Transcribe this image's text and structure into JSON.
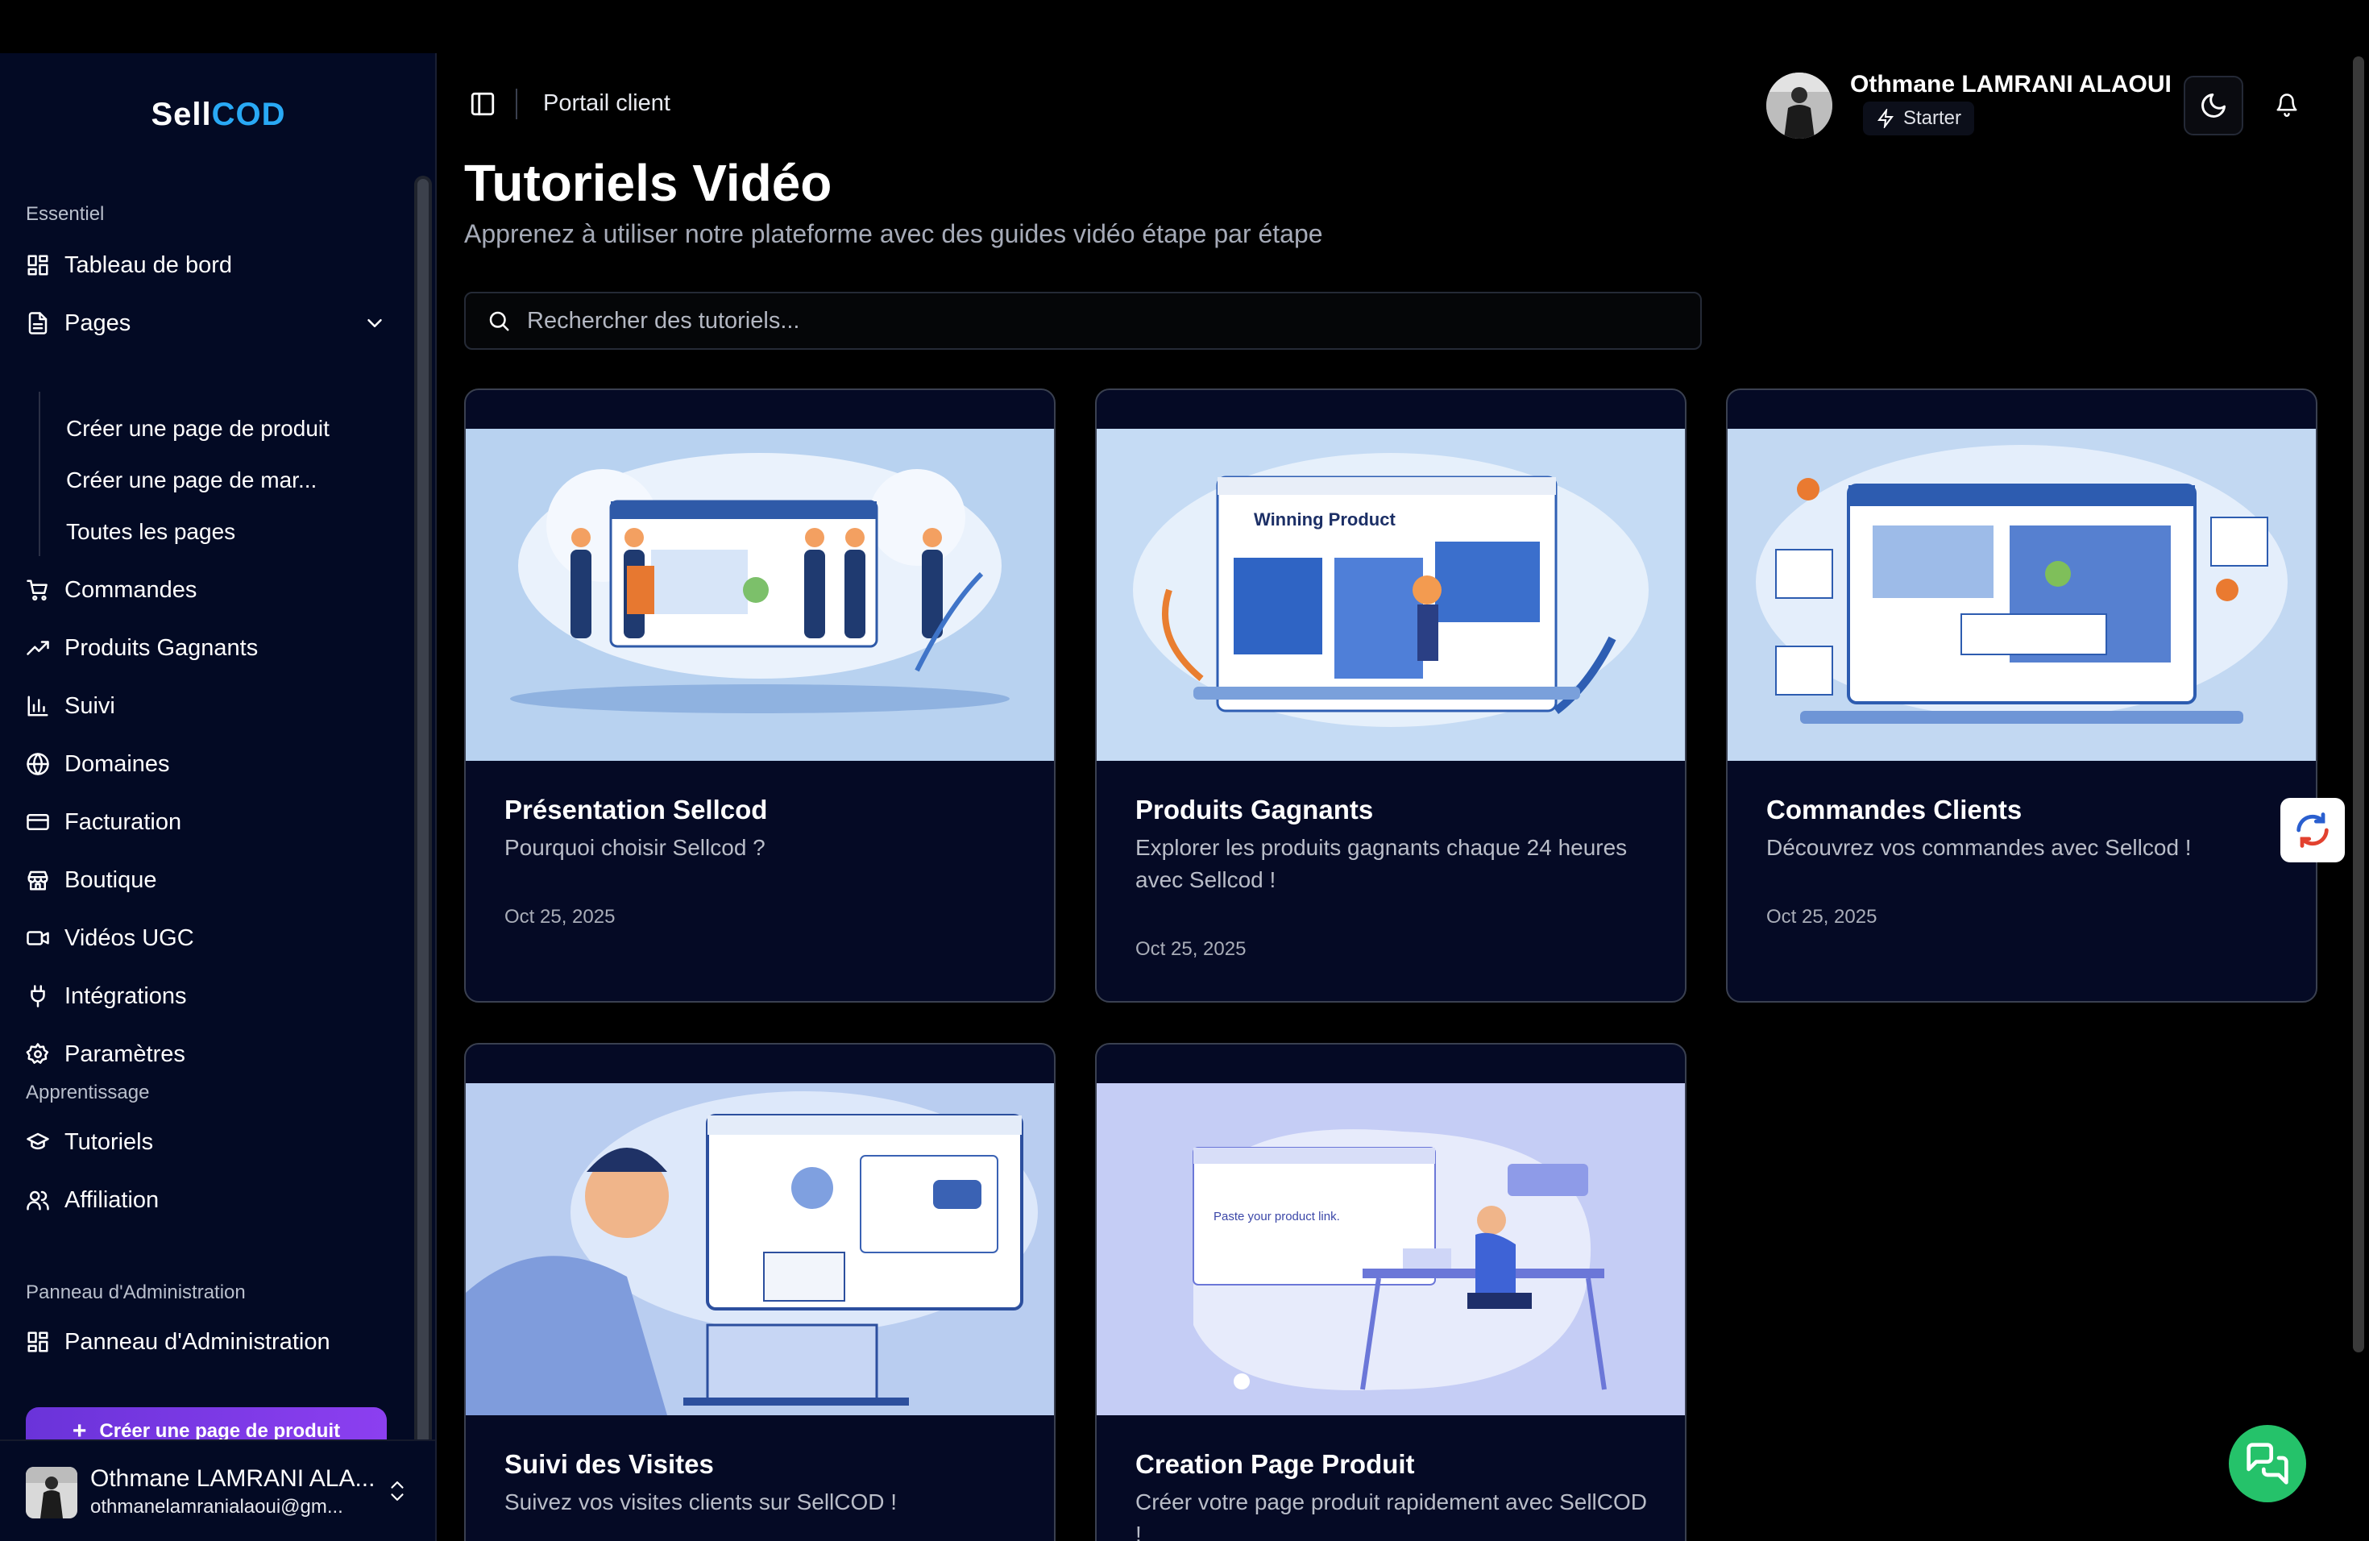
{
  "brand": {
    "part1": "Sell",
    "part2": "COD"
  },
  "sidebar": {
    "sections": [
      "Essentiel",
      "Apprentissage",
      "Panneau d'Administration"
    ],
    "items": [
      {
        "label": "Tableau de bord",
        "icon": "dashboard-icon"
      },
      {
        "label": "Pages",
        "icon": "file-icon"
      },
      {
        "label": "Commandes",
        "icon": "cart-icon"
      },
      {
        "label": "Produits Gagnants",
        "icon": "trending-icon"
      },
      {
        "label": "Suivi",
        "icon": "bar-chart-icon"
      },
      {
        "label": "Domaines",
        "icon": "globe-icon"
      },
      {
        "label": "Facturation",
        "icon": "credit-card-icon"
      },
      {
        "label": "Boutique",
        "icon": "store-icon"
      },
      {
        "label": "Vidéos UGC",
        "icon": "video-icon"
      },
      {
        "label": "Intégrations",
        "icon": "plug-icon"
      },
      {
        "label": "Paramètres",
        "icon": "gear-icon"
      }
    ],
    "pages_sub": [
      "Créer une page de produit",
      "Créer une page de mar...",
      "Toutes les pages"
    ],
    "learning": [
      {
        "label": "Tutoriels",
        "icon": "graduation-cap-icon"
      },
      {
        "label": "Affiliation",
        "icon": "users-icon"
      }
    ],
    "admin": [
      {
        "label": "Panneau d'Administration",
        "icon": "dashboard-icon"
      }
    ],
    "create_button": "Créer une page de produit",
    "user": {
      "name": "Othmane LAMRANI ALA...",
      "email": "othmanelamranialaoui@gm..."
    }
  },
  "header": {
    "breadcrumb": "Portail client",
    "user_name": "Othmane LAMRANI ALAOUI",
    "plan": "Starter"
  },
  "main": {
    "title": "Tutoriels Vidéo",
    "subtitle": "Apprenez à utiliser notre plateforme avec des guides vidéo étape par étape",
    "search_placeholder": "Rechercher des tutoriels...",
    "tutorials": [
      {
        "title": "Présentation Sellcod",
        "description": "Pourquoi choisir Sellcod ?",
        "date": "Oct 25, 2025"
      },
      {
        "title": "Produits Gagnants",
        "description": "Explorer les produits gagnants chaque 24 heures avec Sellcod !",
        "date": "Oct 25, 2025",
        "thumb_text": "Winning Product"
      },
      {
        "title": "Commandes Clients",
        "description": "Découvrez vos commandes avec Sellcod !",
        "date": "Oct 25, 2025"
      },
      {
        "title": "Suivi des Visites",
        "description": "Suivez vos visites clients sur SellCOD !",
        "date": ""
      },
      {
        "title": "Creation Page Produit",
        "description": "Créer votre page produit rapidement avec SellCOD !",
        "date": "",
        "thumb_text": "Paste your product link."
      }
    ]
  },
  "colors": {
    "sidebar_bg": "#030a24",
    "accent_blue": "#29a9f5",
    "cta_purple": "#7a3ae6",
    "chat_green": "#25c26a"
  }
}
